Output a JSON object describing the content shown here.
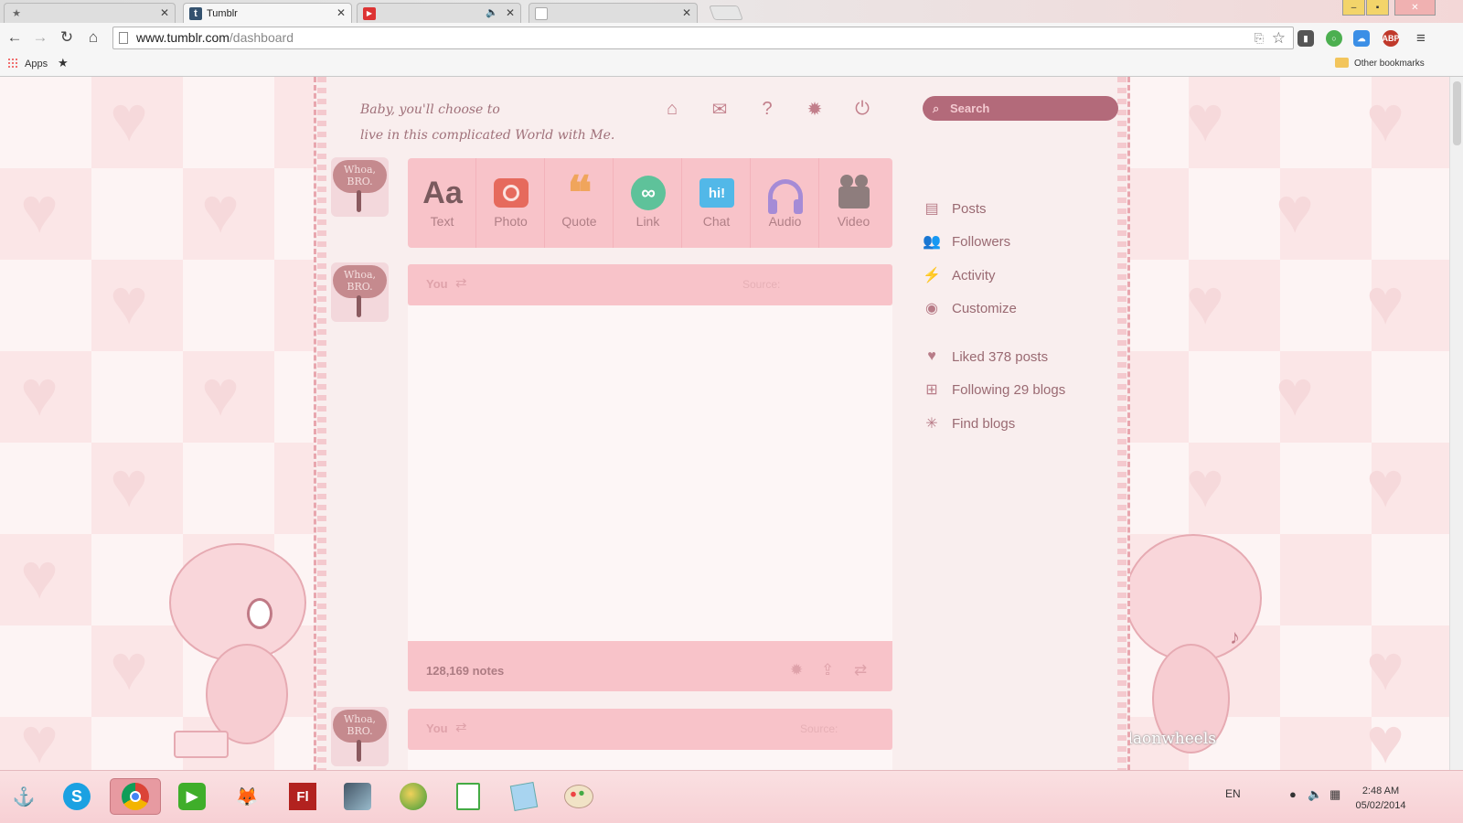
{
  "browser": {
    "tabs": [
      {
        "label": "",
        "icon": "star-icon"
      },
      {
        "label": "Tumblr",
        "icon": "tumblr-icon"
      },
      {
        "label": "",
        "icon": "youtube-icon",
        "audio": true
      },
      {
        "label": "",
        "icon": "page-icon"
      }
    ],
    "url_host": "www.tumblr.com",
    "url_path": "/dashboard",
    "bookmarks": {
      "apps": "Apps",
      "other": "Other bookmarks"
    },
    "window_buttons": [
      "–",
      "▪",
      "✕"
    ]
  },
  "tagline": {
    "line1": "Baby, you'll choose to",
    "line2": "live in this complicated World with Me."
  },
  "header_icons": [
    "home-icon",
    "mail-icon",
    "help-icon",
    "gear-icon",
    "power-icon"
  ],
  "search": {
    "placeholder": "Search"
  },
  "composer": [
    {
      "label": "Text",
      "icon": "Aa",
      "color": "#7a5a5e"
    },
    {
      "label": "Photo",
      "icon": "◘",
      "color": "#e66a5d"
    },
    {
      "label": "Quote",
      "icon": "❝",
      "color": "#f0a55c"
    },
    {
      "label": "Link",
      "icon": "∞",
      "color": "#5ec29a"
    },
    {
      "label": "Chat",
      "icon": "hi!",
      "color": "#52b8e8"
    },
    {
      "label": "Audio",
      "icon": "🎧",
      "color": "#a58bd6"
    },
    {
      "label": "Video",
      "icon": "🎥",
      "color": "#8e7d7d"
    }
  ],
  "avatar_text": "Whoa, BRO.",
  "posts": [
    {
      "author": "You",
      "source_label": "Source:",
      "notes": "128,169 notes"
    },
    {
      "author": "You",
      "source_label": "Source:"
    }
  ],
  "sidebar": [
    {
      "label": "Posts",
      "icon": "posts-icon"
    },
    {
      "label": "Followers",
      "icon": "followers-icon"
    },
    {
      "label": "Activity",
      "icon": "activity-icon"
    },
    {
      "label": "Customize",
      "icon": "customize-icon"
    },
    {
      "label": "Liked 378 posts",
      "icon": "heart-icon"
    },
    {
      "label": "Following 29 blogs",
      "icon": "following-icon"
    },
    {
      "label": "Find blogs",
      "icon": "find-icon"
    }
  ],
  "watermark": "hellaonwheels",
  "taskbar": {
    "apps": [
      "anchor-app",
      "skype-app",
      "chrome-app",
      "media-player-app",
      "gimp-app",
      "flash-app",
      "tool-app",
      "globe-app",
      "chart-app",
      "notes-app",
      "paint-app"
    ],
    "language": "EN",
    "time": "2:48 AM",
    "date": "05/02/2014"
  },
  "colors": {
    "accent": "#f8c3c9",
    "search": "#b36a7a",
    "sidebar_text": "#9a6a72"
  }
}
